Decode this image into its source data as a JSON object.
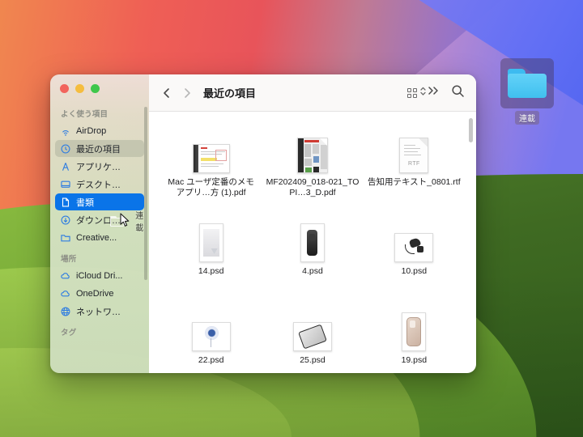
{
  "desktop": {
    "folder": {
      "label": "連載",
      "icon": "folder-icon",
      "selected": true
    }
  },
  "window": {
    "title": "最近の項目",
    "traffic_lights": [
      {
        "name": "close",
        "color": "#f2645c"
      },
      {
        "name": "minimize",
        "color": "#f5bd3f"
      },
      {
        "name": "maximize",
        "color": "#3fc74b"
      }
    ],
    "toolbar": {
      "back": "chevron-left-icon",
      "forward": "chevron-right-icon",
      "view_mode": "icon-grid",
      "overflow": "»",
      "search": "search-icon"
    }
  },
  "sidebar": {
    "sections": [
      {
        "title": "よく使う項目",
        "items": [
          {
            "label": "AirDrop",
            "icon": "airdrop-icon",
            "state": "normal"
          },
          {
            "label": "最近の項目",
            "icon": "clock-icon",
            "state": "current"
          },
          {
            "label": "アプリケ…",
            "icon": "applications-icon",
            "state": "normal"
          },
          {
            "label": "デスクト…",
            "icon": "desktop-icon",
            "state": "normal"
          },
          {
            "label": "書類",
            "icon": "document-icon",
            "state": "selected"
          },
          {
            "label": "ダウンロ…",
            "icon": "downloads-icon",
            "state": "normal"
          },
          {
            "label": "Creative...",
            "icon": "folder-icon",
            "state": "normal"
          }
        ]
      },
      {
        "title": "場所",
        "items": [
          {
            "label": "iCloud Dri...",
            "icon": "cloud-icon",
            "state": "normal"
          },
          {
            "label": "OneDrive",
            "icon": "cloud-icon",
            "state": "normal"
          },
          {
            "label": "ネットワ…",
            "icon": "network-icon",
            "state": "normal"
          }
        ]
      },
      {
        "title": "タグ",
        "items": []
      }
    ]
  },
  "drag": {
    "label": "連載",
    "icon": "folder-icon",
    "cursor": "arrow-cursor"
  },
  "files": [
    {
      "name": "Mac ユーザ定番のメモアプリ…方 (1).pdf",
      "kind": "pdf",
      "thumb": "pdf-page-preview"
    },
    {
      "name": "MF202409_018-021_TOPI…3_D.pdf",
      "kind": "pdf",
      "thumb": "magazine-page-preview"
    },
    {
      "name": "告知用テキスト_0801.rtf",
      "kind": "rtf",
      "thumb": "rtf-document"
    },
    {
      "name": "14.psd",
      "kind": "psd",
      "thumb": "gray-object"
    },
    {
      "name": "4.psd",
      "kind": "psd",
      "thumb": "remote-control"
    },
    {
      "name": "10.psd",
      "kind": "psd",
      "thumb": "cable-adapter"
    },
    {
      "name": "22.psd",
      "kind": "psd",
      "thumb": "disc-object"
    },
    {
      "name": "25.psd",
      "kind": "psd",
      "thumb": "laptop-object"
    },
    {
      "name": "19.psd",
      "kind": "psd",
      "thumb": "phone-case"
    }
  ],
  "colors": {
    "selection_blue": "#0a74e8",
    "sidebar_icon_blue": "#2f7de1",
    "window_bg": "#ffffff"
  }
}
